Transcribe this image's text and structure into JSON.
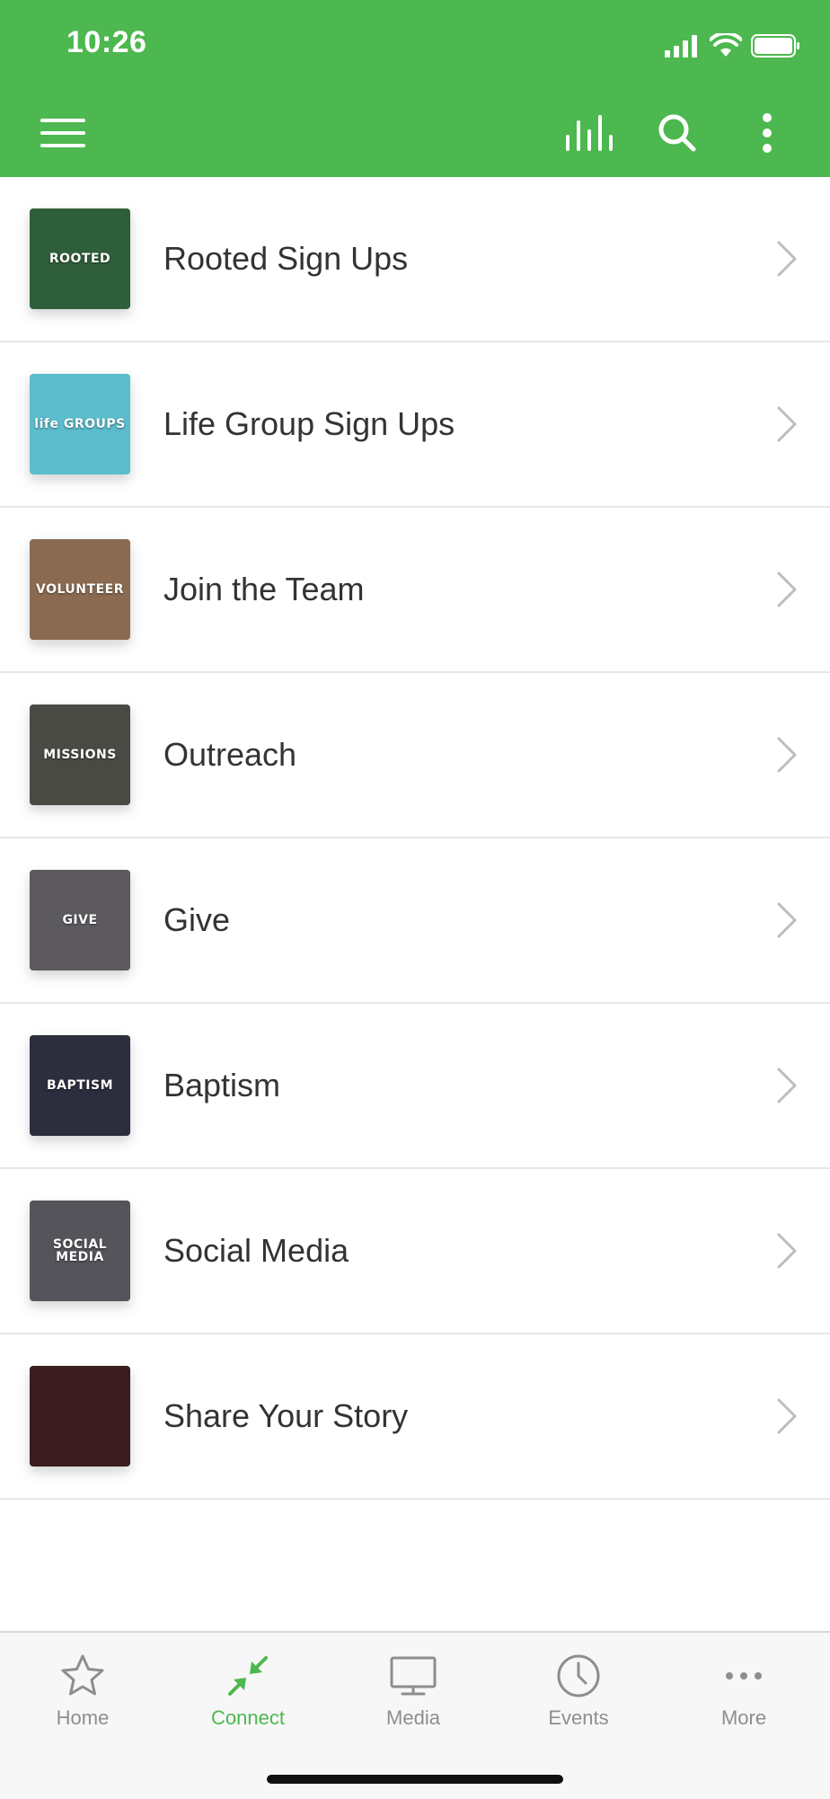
{
  "status_bar": {
    "time": "10:26"
  },
  "colors": {
    "accent": "#4cb84f",
    "tab_inactive": "#8e8e8e",
    "text": "#333333"
  },
  "header": {
    "menu_icon": "hamburger-menu-icon",
    "actions": [
      "bar-chart-icon",
      "search-icon",
      "more-vertical-icon"
    ]
  },
  "list": {
    "items": [
      {
        "label": "Rooted Sign Ups",
        "thumb_text": "ROOTED",
        "thumb_color": "#2f5e3a"
      },
      {
        "label": "Life Group Sign Ups",
        "thumb_text": "life GROUPS",
        "thumb_color": "#5bbccc"
      },
      {
        "label": "Join the Team",
        "thumb_text": "VOLUNTEER",
        "thumb_color": "#8a6b52"
      },
      {
        "label": "Outreach",
        "thumb_text": "MISSIONS",
        "thumb_color": "#4a4a44"
      },
      {
        "label": "Give",
        "thumb_text": "GIVE",
        "thumb_color": "#5c5a5e"
      },
      {
        "label": "Baptism",
        "thumb_text": "BAPTISM",
        "thumb_color": "#2c2d3d"
      },
      {
        "label": "Social Media",
        "thumb_text": "SOCIAL\nMEDIA",
        "thumb_color": "#55545a"
      },
      {
        "label": "Share Your Story",
        "thumb_text": "",
        "thumb_color": "#3b1d1f"
      }
    ]
  },
  "tabbar": {
    "tabs": [
      {
        "label": "Home",
        "icon": "star-icon",
        "active": false
      },
      {
        "label": "Connect",
        "icon": "connect-arrows-icon",
        "active": true
      },
      {
        "label": "Media",
        "icon": "monitor-icon",
        "active": false
      },
      {
        "label": "Events",
        "icon": "clock-icon",
        "active": false
      },
      {
        "label": "More",
        "icon": "more-horizontal-icon",
        "active": false
      }
    ]
  }
}
